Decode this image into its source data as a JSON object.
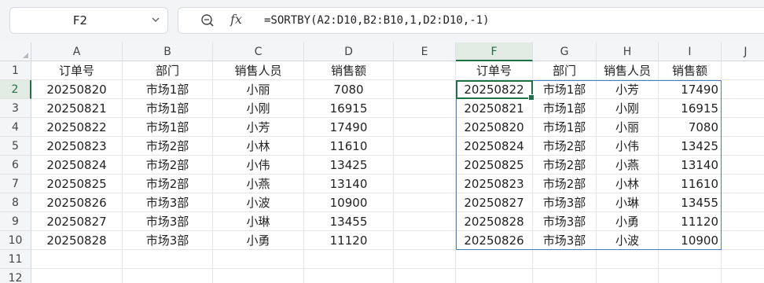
{
  "name_box": {
    "value": "F2"
  },
  "formula_bar": {
    "zoom_icon": "zoom-icon",
    "fx_label": "fx",
    "formula": "=SORTBY(A2:D10,B2:B10,1,D2:D10,-1)"
  },
  "active_cell": "F2",
  "column_headers": [
    "A",
    "B",
    "C",
    "D",
    "E",
    "F",
    "G",
    "H",
    "I",
    "J"
  ],
  "row_headers": [
    "1",
    "2",
    "3",
    "4",
    "5",
    "6",
    "7",
    "8",
    "9",
    "10",
    "11",
    "12"
  ],
  "source_table": {
    "headers": [
      "订单号",
      "部门",
      "销售人员",
      "销售额"
    ],
    "rows": [
      [
        "20250820",
        "市场1部",
        "小丽",
        "7080"
      ],
      [
        "20250821",
        "市场1部",
        "小刚",
        "16915"
      ],
      [
        "20250822",
        "市场1部",
        "小芳",
        "17490"
      ],
      [
        "20250823",
        "市场2部",
        "小林",
        "11610"
      ],
      [
        "20250824",
        "市场2部",
        "小伟",
        "13425"
      ],
      [
        "20250825",
        "市场2部",
        "小燕",
        "13140"
      ],
      [
        "20250826",
        "市场3部",
        "小波",
        "10900"
      ],
      [
        "20250827",
        "市场3部",
        "小琳",
        "13455"
      ],
      [
        "20250828",
        "市场3部",
        "小勇",
        "11120"
      ]
    ]
  },
  "result_table": {
    "headers": [
      "订单号",
      "部门",
      "销售人员",
      "销售额"
    ],
    "rows": [
      [
        "20250822",
        "市场1部",
        "小芳",
        "17490"
      ],
      [
        "20250821",
        "市场1部",
        "小刚",
        "16915"
      ],
      [
        "20250820",
        "市场1部",
        "小丽",
        "7080"
      ],
      [
        "20250824",
        "市场2部",
        "小伟",
        "13425"
      ],
      [
        "20250825",
        "市场2部",
        "小燕",
        "13140"
      ],
      [
        "20250823",
        "市场2部",
        "小林",
        "11610"
      ],
      [
        "20250827",
        "市场3部",
        "小琳",
        "13455"
      ],
      [
        "20250828",
        "市场3部",
        "小勇",
        "11120"
      ],
      [
        "20250826",
        "市场3部",
        "小波",
        "10900"
      ]
    ]
  },
  "colors": {
    "accent": "#1e7145",
    "result_border": "#4a7cc0",
    "header_bg": "#f4f5f7"
  }
}
